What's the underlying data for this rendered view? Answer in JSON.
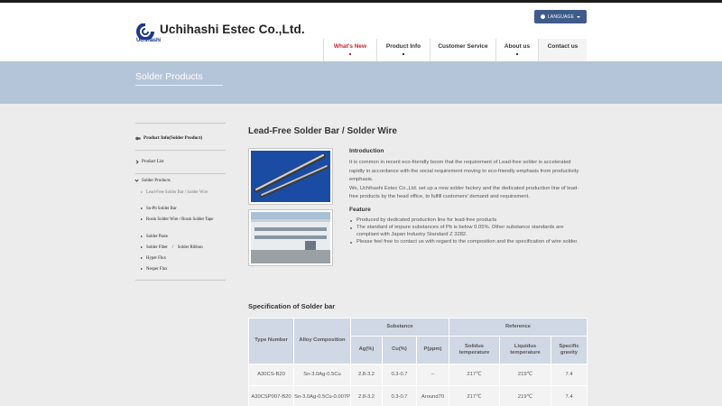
{
  "header": {
    "company_name": "Uchihashi Estec Co.,Ltd.",
    "logo_subtext": "Uchihashi",
    "language_label": "LANGUAGE"
  },
  "nav": [
    {
      "label": "What's New",
      "active": true,
      "has_dropdown": true
    },
    {
      "label": "Product Info",
      "active": false,
      "has_dropdown": true
    },
    {
      "label": "Customer Service",
      "active": false,
      "has_dropdown": false
    },
    {
      "label": "About us",
      "active": false,
      "has_dropdown": true
    },
    {
      "label": "Contact us",
      "active": false,
      "has_dropdown": false
    }
  ],
  "banner": {
    "title": "Solder Products"
  },
  "sidebar": {
    "heading": "Product Info(Solder Product)",
    "items": [
      {
        "label": "Product List"
      },
      {
        "label": "Solder Products"
      }
    ],
    "subitems": [
      {
        "label": "Lead-Free Solder Bar / Solder Wire",
        "current": true
      },
      {
        "label": "Sn-Pb Solder Bar",
        "current": false
      },
      {
        "label": "Rosin Solder Wire / Rosin Solder Tape",
        "current": false
      },
      {
        "label": "Solder Paste",
        "current": false
      },
      {
        "label": "Solder Fiber　/　Solder Ribbon",
        "current": false
      },
      {
        "label": "Hyper Flux",
        "current": false
      },
      {
        "label": "Nesper Flux",
        "current": false
      }
    ]
  },
  "main": {
    "title": "Lead-Free Solder Bar / Solder Wire",
    "intro_heading": "Introduction",
    "intro_p1": "It is common in recent eco-friendly boom that the requirement of Lead-free solder is accelerated rapidly in accordance with the social requirement moving to eco-friendly emphasis from productivity emphasis.",
    "intro_p2": "We, Uchihashi Estec Co.,Ltd. set up a new solder factory and the dedicated production line of lead-free products by the head office, to fulfill customers' demand and requirement.",
    "feature_heading": "Feature",
    "features": [
      "Produced by dedicated production line for lead-free products",
      "The standard of impure substances of Pb is below 0.05%. Other substance standards are compliant with Japan Industry Standard Z 3282.",
      "Please feel free to contact us with regard to the composition and the specification of wire solder."
    ]
  },
  "spec": {
    "heading": "Specification of Solder bar",
    "group_headers": {
      "substance": "Substance",
      "reference": "Reference"
    },
    "columns": {
      "type": "Type Number",
      "alloy": "Alloy Composition",
      "ag": "Ag(%)",
      "cu": "Cu(%)",
      "p": "P(ppm)",
      "solidus": "Solidus temperature",
      "liquidus": "Liquidus temperature",
      "gravity": "Specific gravity"
    },
    "rows": [
      {
        "type": "A30CS-B20",
        "alloy": "Sn-3.0Ag-0.5Cu",
        "ag": "2.8-3.2",
        "cu": "0.3-0.7",
        "p": "–",
        "solidus": "217℃",
        "liquidus": "219℃",
        "gravity": "7.4"
      },
      {
        "type": "A30CSP007-B20",
        "alloy": "Sn-3.0Ag-0.5Cu-0.007P",
        "ag": "2.8-3.2",
        "cu": "0.3-0.7",
        "p": "Around70",
        "solidus": "217℃",
        "liquidus": "219℃",
        "gravity": "7.4"
      }
    ]
  },
  "colors": {
    "accent_red": "#c0272d",
    "banner_blue": "#b5c5d9",
    "table_header": "#cfd8e4",
    "language_button": "#3f5b8a"
  }
}
